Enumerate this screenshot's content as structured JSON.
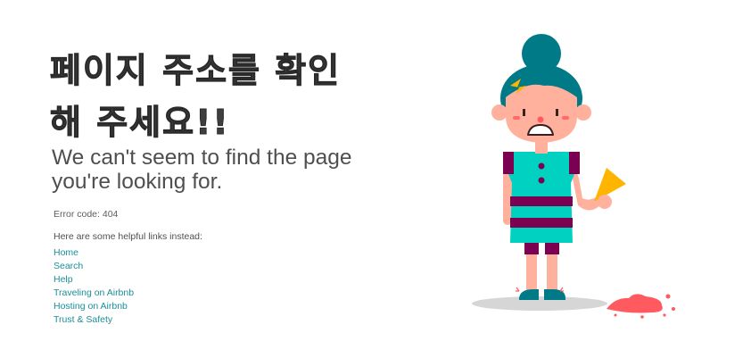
{
  "heading": {
    "line1": "페이지 주소를 확인",
    "line2": "해 주세요!!"
  },
  "subheading": {
    "line1": "We can't seem to find the page",
    "line2": "you're looking for."
  },
  "error_code": "Error code: 404",
  "links_intro": "Here are some helpful links instead:",
  "links": [
    {
      "label": "Home"
    },
    {
      "label": "Search"
    },
    {
      "label": "Help"
    },
    {
      "label": "Traveling on Airbnb"
    },
    {
      "label": "Hosting on Airbnb"
    },
    {
      "label": "Trust & Safety"
    }
  ],
  "colors": {
    "link": "#1a8f98",
    "hair": "#007a87",
    "dress": "#00d1c1",
    "stripe": "#7b0051",
    "skin": "#ffb19e",
    "ice_cream": "#ff5a5f",
    "cone": "#ffb400"
  },
  "illustration": {
    "icon": "girl-dropped-ice-cream-illustration"
  }
}
